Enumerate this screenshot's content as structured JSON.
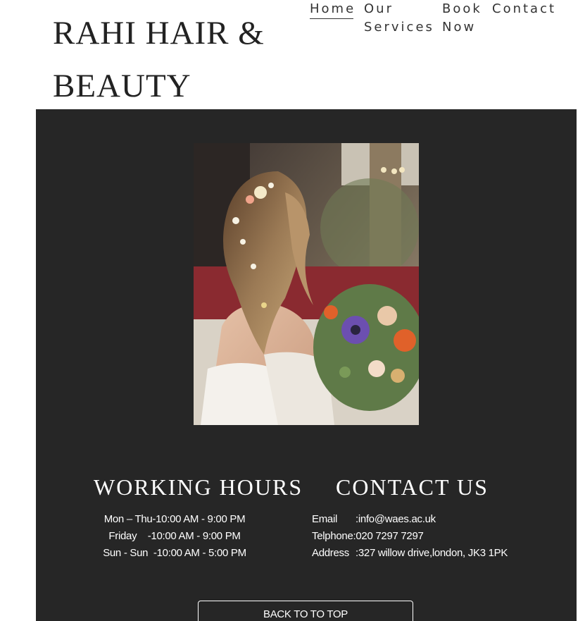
{
  "header": {
    "brand_line1": "RAHI HAIR &",
    "brand_line2": "BEAUTY",
    "nav": {
      "home": "Home",
      "services_line1": "Our",
      "services_line2": "Services",
      "book_line1": "Book",
      "book_line2": "Now",
      "contact": "Contact"
    }
  },
  "hero": {
    "image_description": "bride-with-braided-hair-and-flower-bouquet"
  },
  "working_hours": {
    "title": "WORKING HOURS",
    "rows": [
      "Mon – Thu-10:00 AM - 9:00 PM",
      "Friday    -10:00 AM - 9:00 PM",
      "Sun - Sun  -10:00 AM - 5:00 PM"
    ]
  },
  "contact": {
    "title": "CONTACT US",
    "email_label": "Email",
    "email_value": ":info@waes.ac.uk",
    "phone_label": "Telphone:",
    "phone_value": "020 7297 7297",
    "address_label": "Address",
    "address_value": ":327 willow drive,london, JK3 1PK"
  },
  "footer": {
    "back_to_top": "BACK TO TO TOP"
  },
  "colors": {
    "dark_bg": "#262626",
    "text_light": "#ffffff",
    "text_dark": "#222222"
  }
}
